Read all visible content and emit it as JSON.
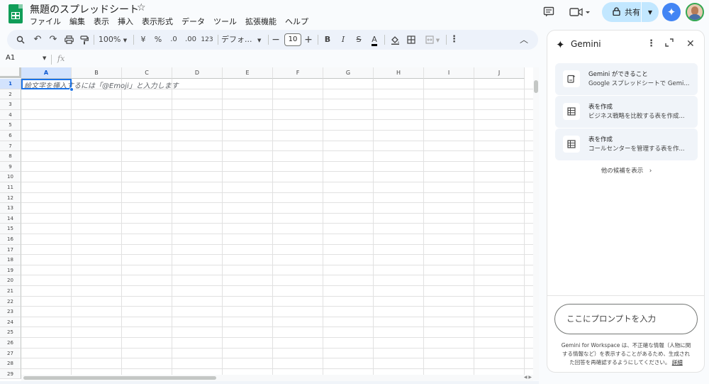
{
  "doc": {
    "title": "無題のスプレッドシート",
    "star_icon": "star-icon"
  },
  "menu": [
    "ファイル",
    "編集",
    "表示",
    "挿入",
    "表示形式",
    "データ",
    "ツール",
    "拡張機能",
    "ヘルプ"
  ],
  "header": {
    "share_label": "共有"
  },
  "toolbar": {
    "zoom": "100%",
    "currency": "¥",
    "percent": "%",
    "dec_minus": ".0",
    "dec_plus": ".00",
    "format_123": "123",
    "font": "デフォ...",
    "font_size": "10",
    "bold": "B",
    "italic": "I",
    "strike": "S",
    "text_color": "A"
  },
  "formula_bar": {
    "name_box": "A1",
    "fx": "fx"
  },
  "grid": {
    "columns": [
      "A",
      "B",
      "C",
      "D",
      "E",
      "F",
      "G",
      "H",
      "I",
      "J"
    ],
    "rows": [
      "1",
      "2",
      "3",
      "4",
      "5",
      "6",
      "7",
      "8",
      "9",
      "10",
      "11",
      "12",
      "13",
      "14",
      "15",
      "16",
      "17",
      "18",
      "19",
      "20",
      "21",
      "22",
      "23",
      "24",
      "25",
      "26",
      "27",
      "28",
      "29"
    ],
    "cell_hint": "絵文字を挿入するには「@Emoji」と入力します"
  },
  "gemini": {
    "title": "Gemini",
    "suggestions": [
      {
        "icon": "sparkle-doc-icon",
        "line1": "Gemini ができること",
        "line2": "Google スプレッドシートで Gemi..."
      },
      {
        "icon": "table-icon",
        "line1": "表を作成",
        "line2": "ビジネス戦略を比較する表を作成..."
      },
      {
        "icon": "table-icon",
        "line1": "表を作成",
        "line2": "コールセンターを管理する表を作..."
      }
    ],
    "more_label": "他の候補を表示",
    "prompt_placeholder": "ここにプロンプトを入力",
    "disclaimer": "Gemini for Workspace は、不正確な情報（人物に関する情報など）を表示することがあるため、生成された回答を再確認するようにしてください。",
    "disclaimer_link": "詳細"
  }
}
